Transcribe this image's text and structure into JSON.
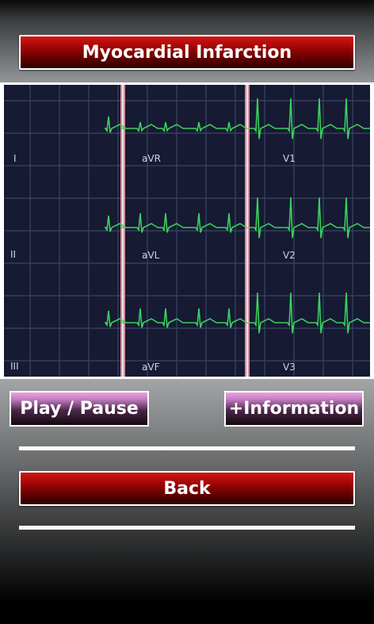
{
  "title": "Myocardial Infarction",
  "ecg": {
    "leads": [
      {
        "label": "I"
      },
      {
        "label": "aVR"
      },
      {
        "label": "V1"
      },
      {
        "label": "II"
      },
      {
        "label": "aVL"
      },
      {
        "label": "V2"
      },
      {
        "label": "III"
      },
      {
        "label": "aVF"
      },
      {
        "label": "V3"
      }
    ],
    "colors": {
      "background": "#161a33",
      "grid": "#3c4566",
      "trace": "#39d15a",
      "divider": "#e89aa4"
    }
  },
  "buttons": {
    "play_pause": "Play / Pause",
    "information": "+Information",
    "back": "Back"
  },
  "colors": {
    "title_red": "#b00303",
    "pink_button": "#c77fc4"
  }
}
